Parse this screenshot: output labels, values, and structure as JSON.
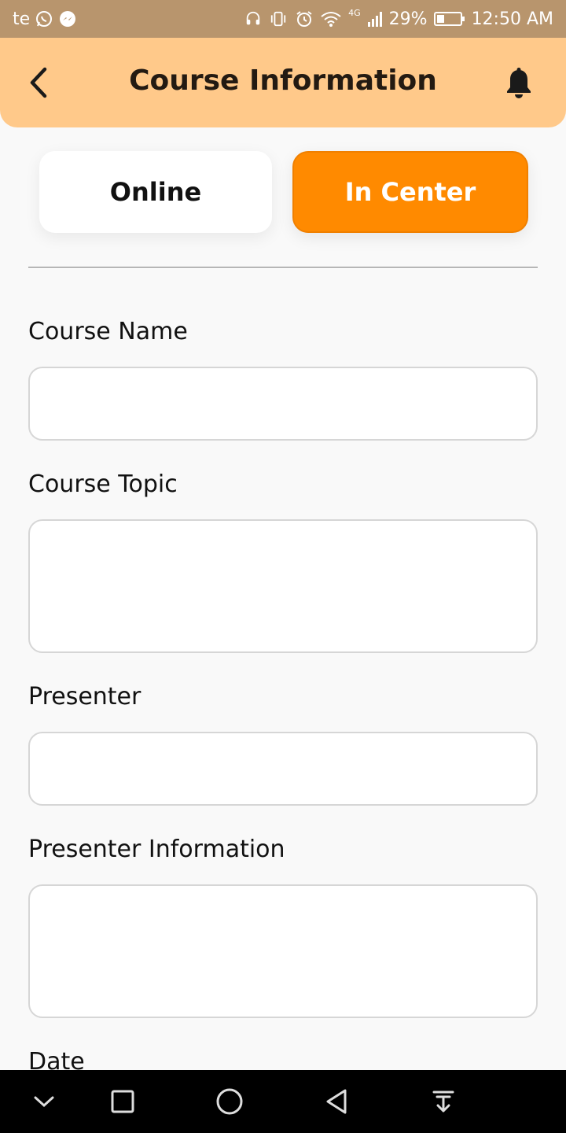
{
  "status_bar": {
    "carrier": "te",
    "battery": "29%",
    "time": "12:50 AM",
    "network": "4G",
    "icons": [
      "whatsapp-icon",
      "messenger-icon",
      "headset-icon",
      "vibrate-icon",
      "alarm-icon",
      "wifi-icon",
      "signal-icon",
      "battery-icon"
    ]
  },
  "header": {
    "title": "Course Information",
    "icons": {
      "back": "back-arrow-icon",
      "notifications": "bell-icon"
    }
  },
  "toggle": {
    "online_label": "Online",
    "in_center_label": "In Center",
    "selected": "In Center"
  },
  "form": {
    "course_name": {
      "label": "Course Name",
      "value": "",
      "placeholder": ""
    },
    "course_topic": {
      "label": "Course Topic",
      "value": "",
      "placeholder": ""
    },
    "presenter": {
      "label": "Presenter",
      "value": "",
      "placeholder": ""
    },
    "presenter_information": {
      "label": "Presenter Information",
      "value": "",
      "placeholder": ""
    },
    "date": {
      "label": "Date"
    }
  },
  "nav_bar": {
    "icons": [
      "chevron-down-icon",
      "recent-apps-icon",
      "home-icon",
      "back-icon",
      "notification-pull-icon"
    ]
  },
  "colors": {
    "status_bar": "#b8956d",
    "header": "#ffc98a",
    "accent": "#ff8a00",
    "background": "#f9f9f9"
  }
}
